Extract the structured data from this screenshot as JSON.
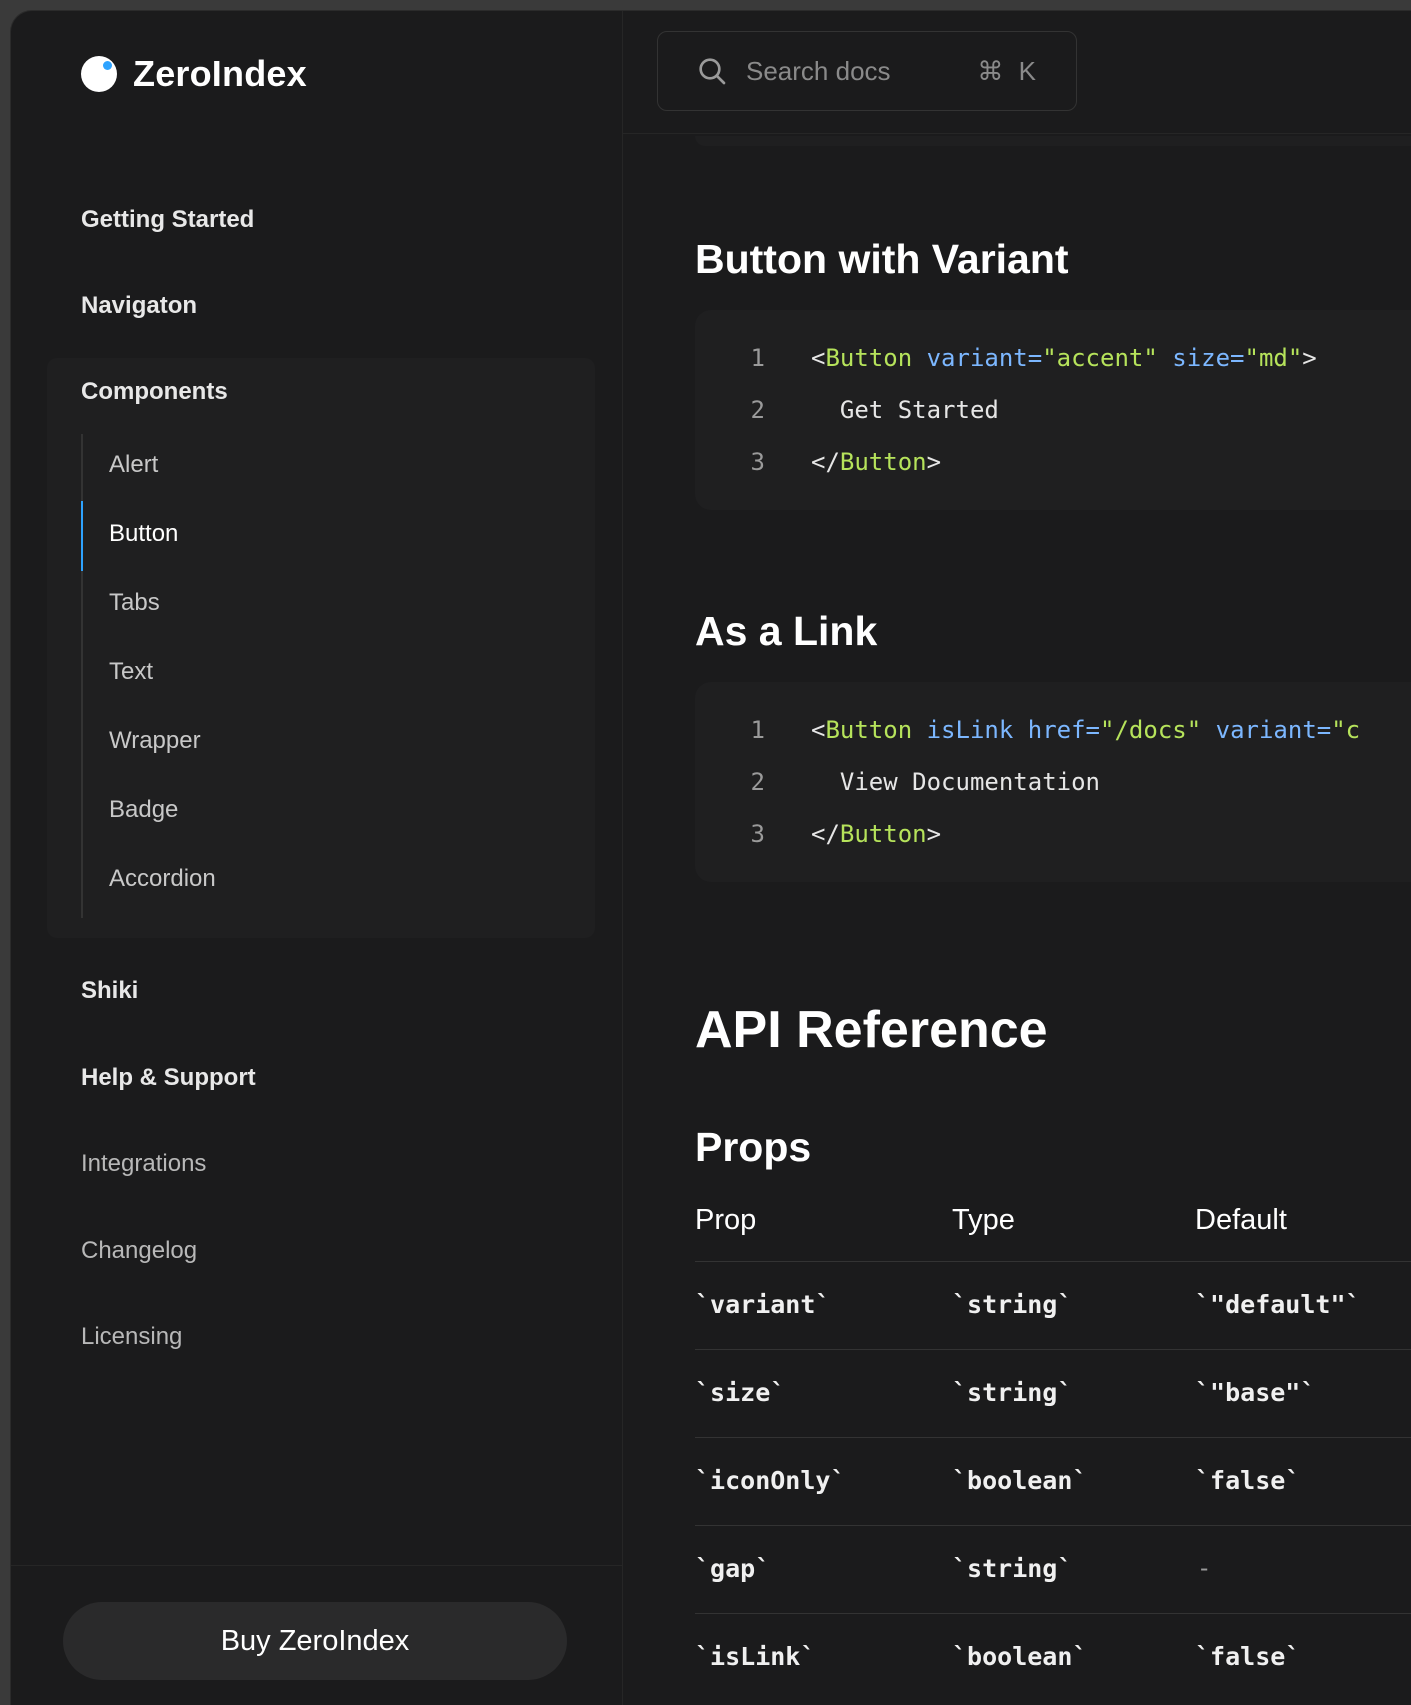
{
  "brand": {
    "name": "ZeroIndex"
  },
  "search": {
    "placeholder": "Search docs",
    "shortcut": "⌘ K"
  },
  "sidebar": {
    "top_items": [
      "Getting Started",
      "Navigaton"
    ],
    "components": {
      "label": "Components",
      "items": [
        "Alert",
        "Button",
        "Tabs",
        "Text",
        "Wrapper",
        "Badge",
        "Accordion"
      ],
      "active": "Button"
    },
    "bottom_items": [
      "Shiki",
      "Help & Support",
      "Integrations",
      "Changelog",
      "Licensing"
    ],
    "buy_label": "Buy ZeroIndex"
  },
  "sections": {
    "variant_title": "Button with Variant",
    "link_title": "As a Link",
    "api_title": "API Reference",
    "props_title": "Props"
  },
  "code_variant": {
    "line_numbers": [
      "1",
      "2",
      "3"
    ],
    "line1": {
      "open": "<",
      "tag": "Button",
      "attr1": " variant=",
      "val1": "\"accent\"",
      "attr2": " size=",
      "val2": "\"md\"",
      "close": ">"
    },
    "line2": "  Get Started",
    "line3": {
      "open": "</",
      "tag": "Button",
      "close": ">"
    }
  },
  "code_link": {
    "line_numbers": [
      "1",
      "2",
      "3"
    ],
    "line1": {
      "open": "<",
      "tag": "Button",
      "attr1": " isLink",
      "attr2": " href=",
      "val2": "\"/docs\"",
      "attr3": " variant=",
      "val3": "\"c"
    },
    "line2": "  View Documentation",
    "line3": {
      "open": "</",
      "tag": "Button",
      "close": ">"
    }
  },
  "props": {
    "headers": [
      "Prop",
      "Type",
      "Default"
    ],
    "rows": [
      [
        "`variant`",
        "`string`",
        "`\"default\"`"
      ],
      [
        "`size`",
        "`string`",
        "`\"base\"`"
      ],
      [
        "`iconOnly`",
        "`boolean`",
        "`false`"
      ],
      [
        "`gap`",
        "`string`",
        "-"
      ],
      [
        "`isLink`",
        "`boolean`",
        "`false`"
      ]
    ]
  }
}
